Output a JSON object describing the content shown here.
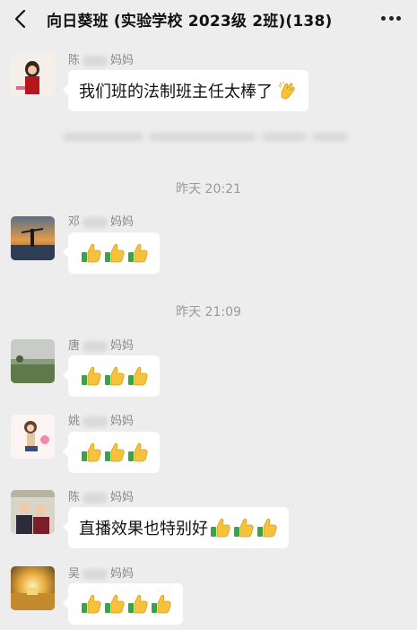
{
  "header": {
    "title": "向日葵班 (实验学校 2023级 2班)(138)",
    "back_icon": "chevron-left-icon",
    "more_icon": "more-dots-icon"
  },
  "messages": [
    {
      "sender": "陈",
      "sender_suffix": "妈妈",
      "text": "我们班的法制班主任太棒了",
      "emoji": [
        "clap"
      ]
    },
    {
      "sender": "邓",
      "sender_suffix": "妈妈",
      "text": "",
      "emoji": [
        "thumbs-up",
        "thumbs-up",
        "thumbs-up"
      ]
    },
    {
      "sender": "唐",
      "sender_suffix": "妈妈",
      "text": "",
      "emoji": [
        "thumbs-up",
        "thumbs-up",
        "thumbs-up"
      ]
    },
    {
      "sender": "姚",
      "sender_suffix": "妈妈",
      "text": "",
      "emoji": [
        "thumbs-up",
        "thumbs-up",
        "thumbs-up"
      ]
    },
    {
      "sender": "陈",
      "sender_suffix": "妈妈",
      "text": "直播效果也特别好",
      "emoji": [
        "thumbs-up",
        "thumbs-up",
        "thumbs-up"
      ]
    },
    {
      "sender": "吴",
      "sender_suffix": "妈妈",
      "text": "",
      "emoji": [
        "thumbs-up",
        "thumbs-up",
        "thumbs-up",
        "thumbs-up"
      ]
    }
  ],
  "timestamps": [
    "昨天 20:21",
    "昨天 21:09"
  ]
}
